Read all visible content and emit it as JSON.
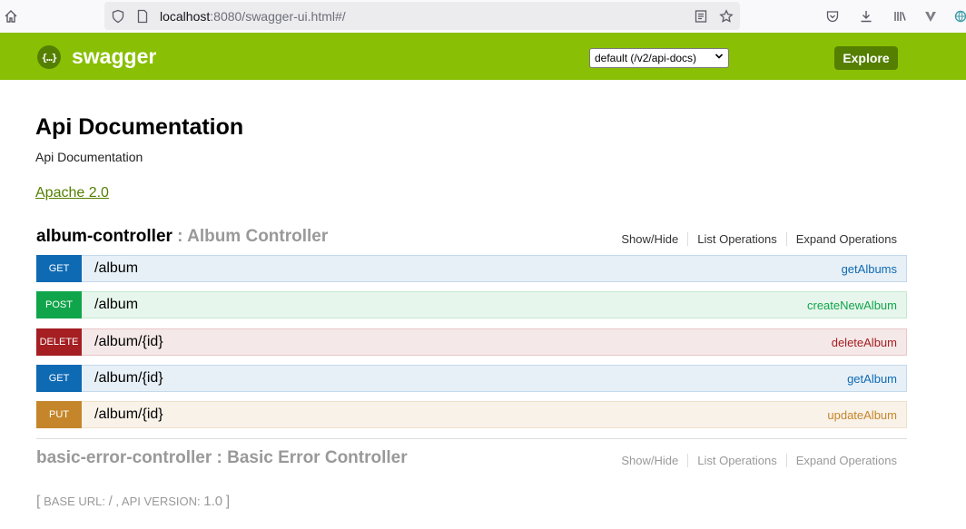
{
  "browser": {
    "url_host": "localhost",
    "url_rest": ":8080/swagger-ui.html#/"
  },
  "header": {
    "logo_glyph": "{…}",
    "title": "swagger",
    "spec_select": "default (/v2/api-docs)",
    "explore_label": "Explore"
  },
  "info": {
    "title": "Api Documentation",
    "description": "Api Documentation",
    "license": "Apache 2.0"
  },
  "resources": [
    {
      "name": "album-controller",
      "separator": " : ",
      "description": "Album Controller",
      "options": [
        "Show/Hide",
        "List Operations",
        "Expand Operations"
      ],
      "operations": [
        {
          "method": "GET",
          "path": "/album",
          "nickname": "getAlbums"
        },
        {
          "method": "POST",
          "path": "/album",
          "nickname": "createNewAlbum"
        },
        {
          "method": "DELETE",
          "path": "/album/{id}",
          "nickname": "deleteAlbum"
        },
        {
          "method": "GET",
          "path": "/album/{id}",
          "nickname": "getAlbum"
        },
        {
          "method": "PUT",
          "path": "/album/{id}",
          "nickname": "updateAlbum"
        }
      ]
    },
    {
      "name": "basic-error-controller",
      "separator": " : ",
      "description": "Basic Error Controller",
      "options": [
        "Show/Hide",
        "List Operations",
        "Expand Operations"
      ]
    }
  ],
  "footer": {
    "open": "[",
    "base_url_label": "BASE URL",
    "base_url_value": "/",
    "api_version_label": "API VERSION",
    "api_version_value": "1.0",
    "close": "]"
  },
  "colors": {
    "header_bg": "#89bf04",
    "explore_bg": "#547f00",
    "get": "#0f6ab4",
    "post": "#10a54a",
    "delete": "#a41e22",
    "put": "#c5862b"
  }
}
